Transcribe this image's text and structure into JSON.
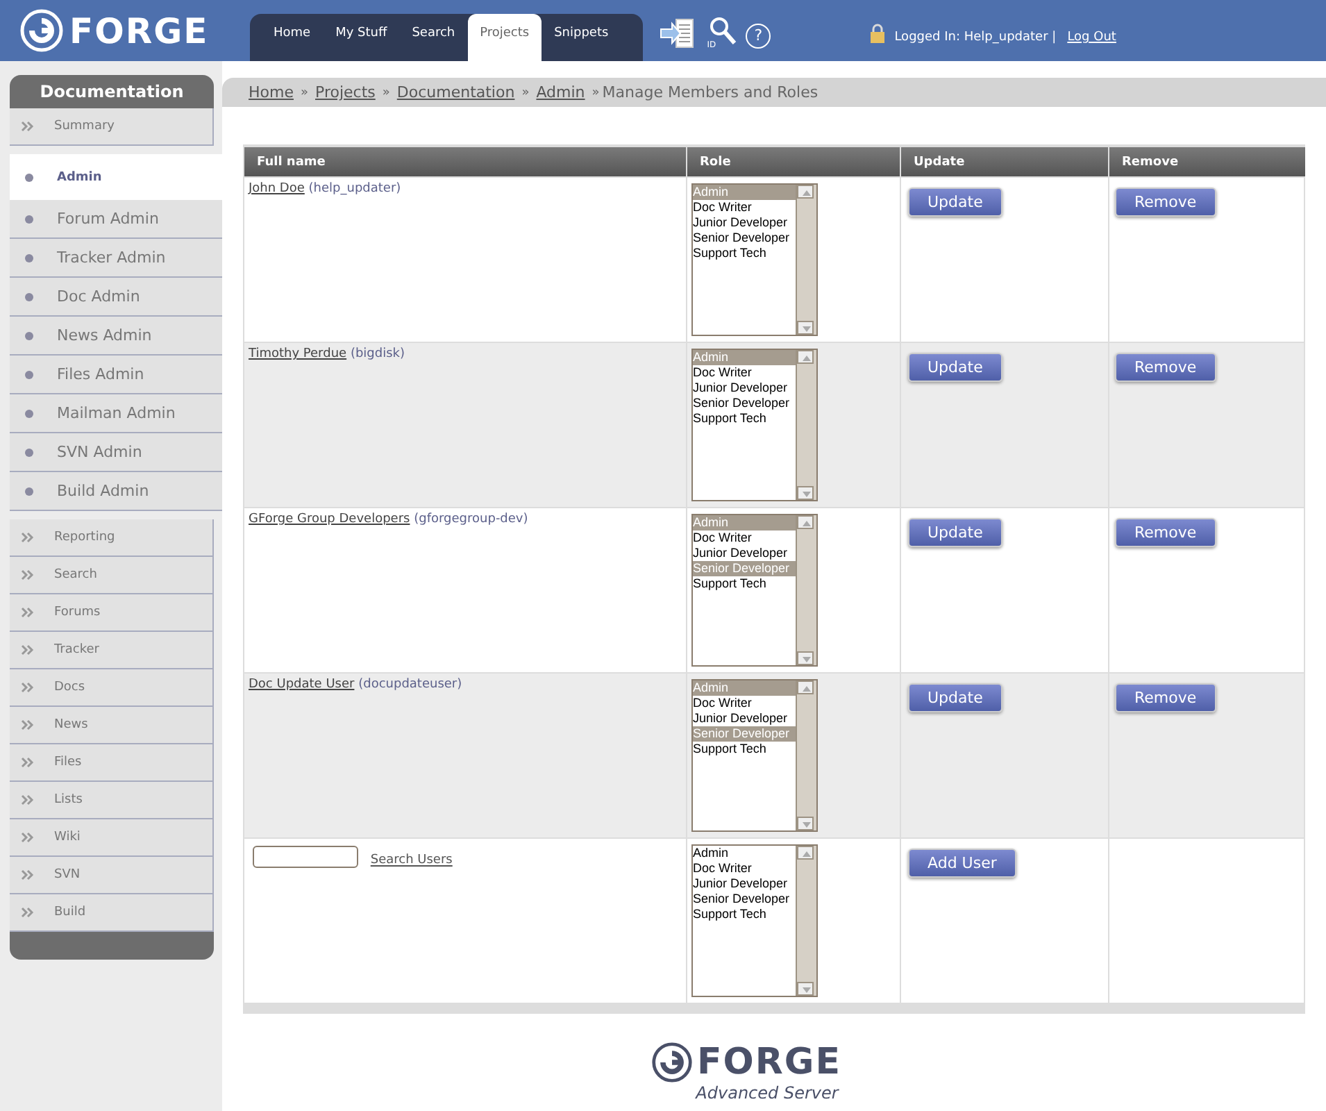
{
  "header": {
    "logo": "FORGE",
    "nav_tabs": [
      {
        "label": "Home",
        "selected": false
      },
      {
        "label": "My Stuff",
        "selected": false
      },
      {
        "label": "Search",
        "selected": false
      },
      {
        "label": "Projects",
        "selected": true
      },
      {
        "label": "Snippets",
        "selected": false
      }
    ],
    "id_label": "ID",
    "help_icon": "?",
    "login_text": "Logged In: Help_updater |",
    "logout": "Log Out"
  },
  "sidebar": {
    "title": "Documentation",
    "groups": [
      [
        {
          "label": "Summary",
          "kind": "section",
          "selected": false
        },
        {
          "label": "Admin",
          "kind": "sub",
          "selected": true
        },
        {
          "label": "Forum Admin",
          "kind": "sub",
          "selected": false
        },
        {
          "label": "Tracker Admin",
          "kind": "sub",
          "selected": false
        },
        {
          "label": "Doc Admin",
          "kind": "sub",
          "selected": false
        },
        {
          "label": "News Admin",
          "kind": "sub",
          "selected": false
        },
        {
          "label": "Files Admin",
          "kind": "sub",
          "selected": false
        },
        {
          "label": "Mailman Admin",
          "kind": "sub",
          "selected": false
        },
        {
          "label": "SVN Admin",
          "kind": "sub",
          "selected": false
        },
        {
          "label": "Build Admin",
          "kind": "sub",
          "selected": false
        }
      ],
      [
        {
          "label": "Reporting",
          "kind": "section",
          "selected": false
        },
        {
          "label": "Search",
          "kind": "section",
          "selected": false
        },
        {
          "label": "Forums",
          "kind": "section",
          "selected": false
        },
        {
          "label": "Tracker",
          "kind": "section",
          "selected": false
        },
        {
          "label": "Docs",
          "kind": "section",
          "selected": false
        },
        {
          "label": "News",
          "kind": "section",
          "selected": false
        },
        {
          "label": "Files",
          "kind": "section",
          "selected": false
        },
        {
          "label": "Lists",
          "kind": "section",
          "selected": false
        },
        {
          "label": "Wiki",
          "kind": "section",
          "selected": false
        },
        {
          "label": "SVN",
          "kind": "section",
          "selected": false
        },
        {
          "label": "Build",
          "kind": "section",
          "selected": false
        }
      ]
    ]
  },
  "breadcrumb": {
    "links": [
      "Home",
      "Projects",
      "Documentation",
      "Admin"
    ],
    "separator": "»",
    "current": "Manage Members and Roles"
  },
  "table": {
    "columns": [
      "Full name",
      "Role",
      "Update",
      "Remove"
    ],
    "rows": [
      {
        "name": "John Doe",
        "user": "(help_updater)",
        "roles": [
          {
            "label": "Admin",
            "selected": true
          },
          {
            "label": "Doc Writer",
            "selected": false
          },
          {
            "label": "Junior Developer",
            "selected": false
          },
          {
            "label": "Senior Developer",
            "selected": false
          },
          {
            "label": "Support Tech",
            "selected": false
          }
        ],
        "update": "Update",
        "remove": "Remove"
      },
      {
        "name": "Timothy Perdue",
        "user": "(bigdisk)",
        "roles": [
          {
            "label": "Admin",
            "selected": true
          },
          {
            "label": "Doc Writer",
            "selected": false
          },
          {
            "label": "Junior Developer",
            "selected": false
          },
          {
            "label": "Senior Developer",
            "selected": false
          },
          {
            "label": "Support Tech",
            "selected": false
          }
        ],
        "update": "Update",
        "remove": "Remove"
      },
      {
        "name": "GForge Group Developers",
        "user": "(gforgegroup-dev)",
        "roles": [
          {
            "label": "Admin",
            "selected": true
          },
          {
            "label": "Doc Writer",
            "selected": false
          },
          {
            "label": "Junior Developer",
            "selected": false
          },
          {
            "label": "Senior Developer",
            "selected": true
          },
          {
            "label": "Support Tech",
            "selected": false
          }
        ],
        "update": "Update",
        "remove": "Remove"
      },
      {
        "name": "Doc Update User",
        "user": "(docupdateuser)",
        "roles": [
          {
            "label": "Admin",
            "selected": true
          },
          {
            "label": "Doc Writer",
            "selected": false
          },
          {
            "label": "Junior Developer",
            "selected": false
          },
          {
            "label": "Senior Developer",
            "selected": true
          },
          {
            "label": "Support Tech",
            "selected": false
          }
        ],
        "update": "Update",
        "remove": "Remove"
      }
    ],
    "add_row": {
      "search_link": "Search Users",
      "roles": [
        {
          "label": "Admin",
          "selected": false
        },
        {
          "label": "Doc Writer",
          "selected": false
        },
        {
          "label": "Junior Developer",
          "selected": false
        },
        {
          "label": "Senior Developer",
          "selected": false
        },
        {
          "label": "Support Tech",
          "selected": false
        }
      ],
      "button": "Add User"
    }
  },
  "footer": {
    "logo": "FORGE",
    "tagline": "Advanced Server"
  }
}
